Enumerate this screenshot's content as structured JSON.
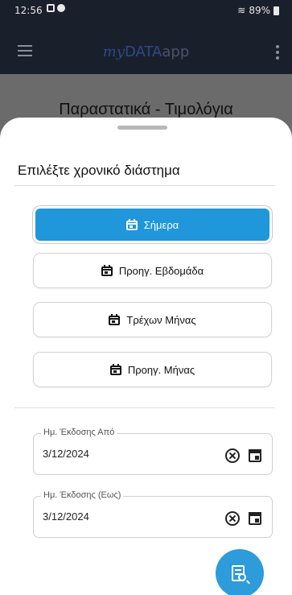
{
  "status": {
    "time": "12:56",
    "battery": "89%"
  },
  "app": {
    "logo_my": "my",
    "logo_data": "DATA",
    "logo_app": "app"
  },
  "background": {
    "title": "Παραστατικά - Τιμολόγια"
  },
  "sheet": {
    "title": "Επιλέξτε χρονικό διάστημα",
    "presets": [
      {
        "label": "Σήμερα",
        "selected": true,
        "icon": "calendar-today-icon"
      },
      {
        "label": "Προηγ. Εβδομάδα",
        "selected": false,
        "icon": "calendar-week-icon"
      },
      {
        "label": "Τρέχων Μήνας",
        "selected": false,
        "icon": "calendar-month-icon"
      },
      {
        "label": "Προηγ. Μήνας",
        "selected": false,
        "icon": "calendar-previous-month-icon"
      }
    ],
    "date_from": {
      "label": "Ημ. Έκδοσης Από",
      "value": "3/12/2024"
    },
    "date_to": {
      "label": "Ημ. Έκδοσης (Εως)",
      "value": "3/12/2024"
    }
  },
  "colors": {
    "accent": "#1f97da",
    "appbar": "#1a1f2c",
    "fab": "#2e9bda"
  },
  "icons": {
    "fab": "search-document-icon",
    "clear": "clear-circle-icon",
    "calendar": "calendar-icon",
    "menu": "hamburger-menu-icon",
    "more": "more-vert-icon"
  }
}
